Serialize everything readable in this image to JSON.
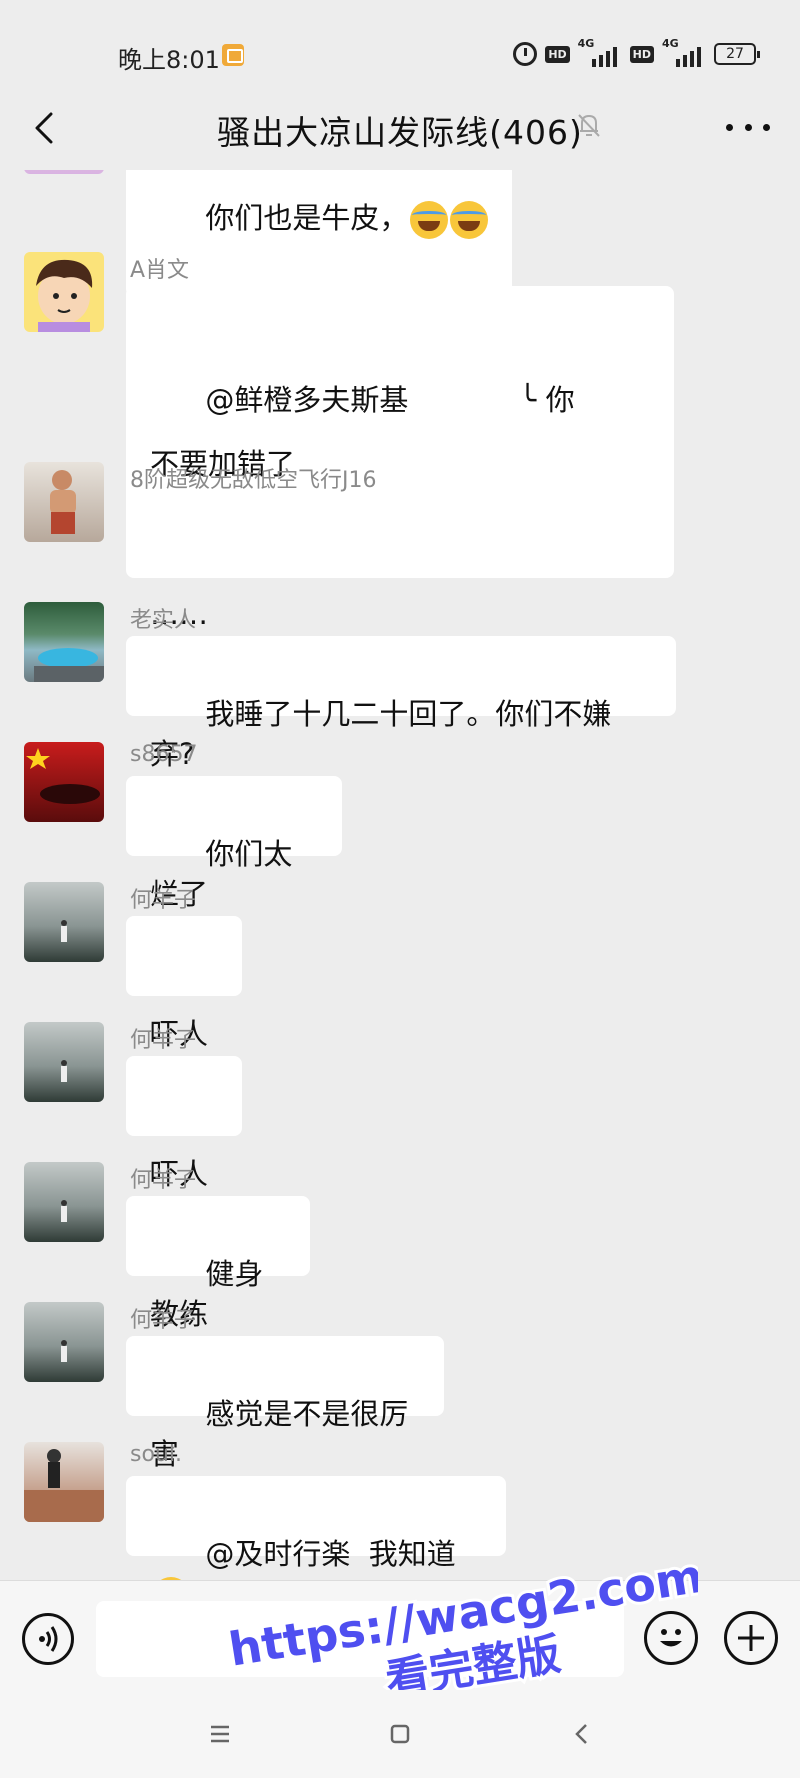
{
  "status_bar": {
    "time": "晚上8:01",
    "hd1": "HD",
    "net1": "4G",
    "hd2": "HD",
    "net2": "4G",
    "battery": "27"
  },
  "header": {
    "title": "骚出大凉山发际线(406)",
    "back_icon": "chevron-left-icon",
    "mute_icon": "bell-off-icon",
    "more_icon": "more-dots-icon"
  },
  "messages": [
    {
      "sender": "",
      "text": "你们也是牛皮，",
      "emoji": [
        "laughing-crying-emoji",
        "laughing-crying-emoji"
      ]
    },
    {
      "sender": "A肖文",
      "text": "@鲜橙多夫斯基            ╰ 你\n不要加错了"
    },
    {
      "sender": "8阶超级无敌低空飞行J16",
      "text": "……"
    },
    {
      "sender": "老实人",
      "text": "我睡了十几二十回了。你们不嫌弃?"
    },
    {
      "sender": "s8657",
      "text": "你们太烂了"
    },
    {
      "sender": "何羊子",
      "text": "吓人"
    },
    {
      "sender": "何羊子",
      "text": "吓人"
    },
    {
      "sender": "何羊子",
      "text": "健身教练"
    },
    {
      "sender": "何羊子",
      "text": "感觉是不是很厉害"
    },
    {
      "sender": "soul.",
      "text": "@及时行楽  我知道",
      "emoji": [
        "laughing-crying-emoji"
      ]
    }
  ],
  "input_bar": {
    "voice_icon": "voice-icon",
    "emoji_icon": "smiley-icon",
    "plus_icon": "plus-icon",
    "input_value": ""
  },
  "watermark": {
    "line1": "https://wacg2.com",
    "line2": "看完整版"
  },
  "system_nav": {
    "menu_icon": "menu-icon",
    "home_icon": "home-square-icon",
    "back_icon": "back-triangle-icon"
  }
}
